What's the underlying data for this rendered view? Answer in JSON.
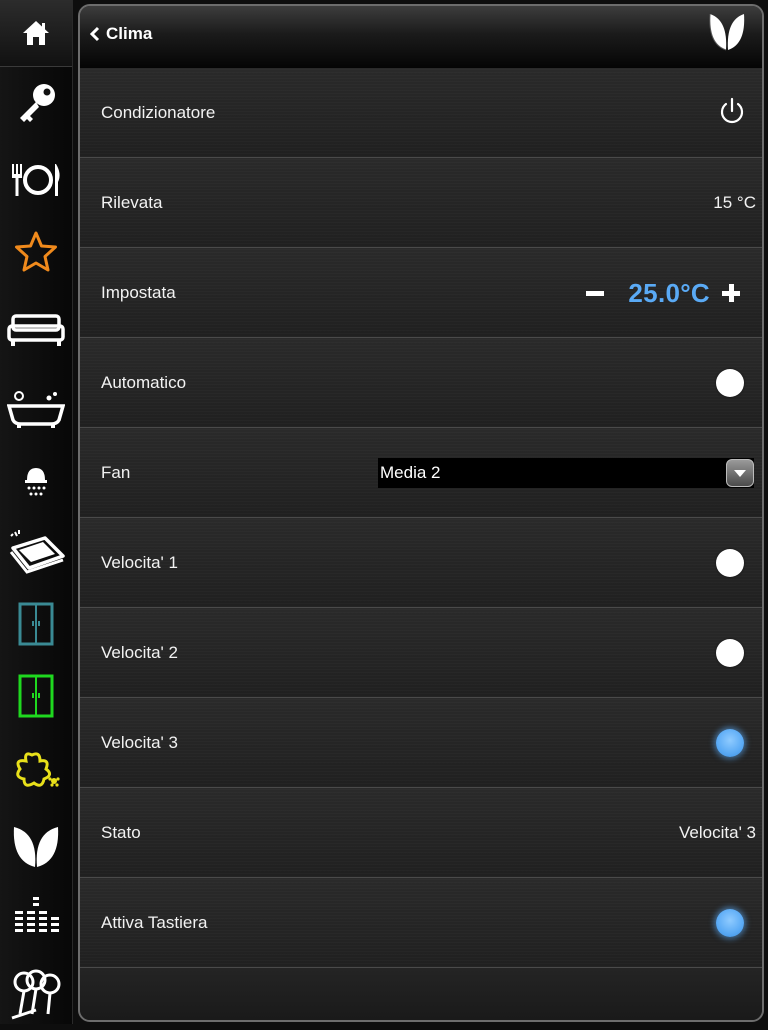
{
  "header": {
    "back_label": "Clima"
  },
  "rows": [
    {
      "label": "Condizionatore",
      "control": "power-icon"
    },
    {
      "label": "Rilevata",
      "value": "15 °C"
    },
    {
      "label": "Impostata",
      "setpoint": "25.0°C"
    },
    {
      "label": "Automatico",
      "toggle": false
    },
    {
      "label": "Fan",
      "select_value": "Media 2"
    },
    {
      "label": "Velocita' 1",
      "toggle": false
    },
    {
      "label": "Velocita' 2",
      "toggle": false
    },
    {
      "label": "Velocita' 3",
      "toggle": true
    },
    {
      "label": "Stato",
      "value": "Velocita' 3"
    },
    {
      "label": "Attiva Tastiera",
      "toggle": true
    }
  ],
  "sidebar": {
    "items": [
      "home-icon",
      "key-icon",
      "dining-icon",
      "star-icon",
      "sofa-icon",
      "bathtub-icon",
      "shower-icon",
      "laptop-icon",
      "window-teal-icon",
      "window-green-icon",
      "garden-flower-icon",
      "leaf-icon",
      "equalizer-icon",
      "garden-trees-icon"
    ]
  },
  "colors": {
    "accent_blue": "#5aaaf5",
    "star_orange": "#f08a1c",
    "window_teal": "#3a8a94",
    "window_green": "#1fd81f",
    "flower_yellow": "#e8e01a"
  }
}
